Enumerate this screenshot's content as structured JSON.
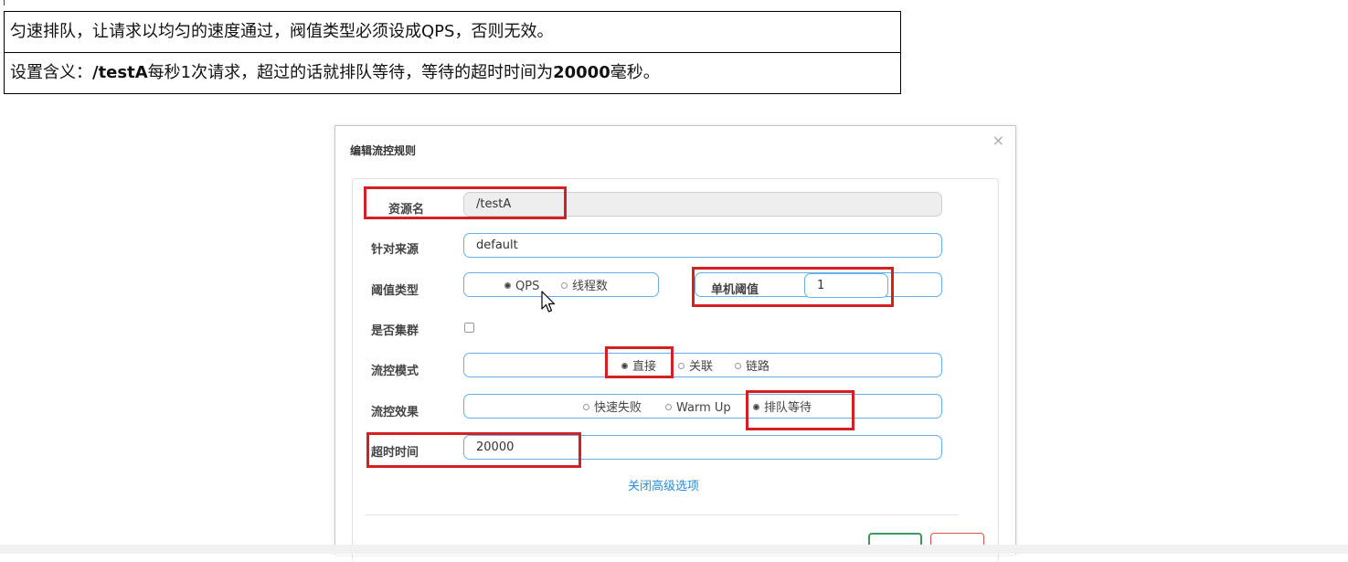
{
  "description": {
    "row1": "匀速排队，让请求以均匀的速度通过，阀值类型必须设成QPS，否则无效。",
    "row2_prefix": "设置含义：",
    "row2_bold": "/testA",
    "row2_mid": "每秒1次请求，超过的话就排队等待，等待的超时时间为",
    "row2_num": "20000",
    "row2_suffix": "毫秒。"
  },
  "dialog": {
    "title": "编辑流控规则",
    "close": "×",
    "resource": {
      "label": "资源名",
      "value": "/testA"
    },
    "origin": {
      "label": "针对来源",
      "value": "default"
    },
    "threshold_type": {
      "label": "阈值类型",
      "options": [
        "QPS",
        "线程数"
      ],
      "selected": "QPS"
    },
    "single_threshold": {
      "label": "单机阈值",
      "value": "1"
    },
    "cluster": {
      "label": "是否集群",
      "checked": false
    },
    "flow_mode": {
      "label": "流控模式",
      "options": [
        "直接",
        "关联",
        "链路"
      ],
      "selected": "直接"
    },
    "flow_effect": {
      "label": "流控效果",
      "options": [
        "快速失败",
        "Warm Up",
        "排队等待"
      ],
      "selected": "排队等待"
    },
    "timeout": {
      "label": "超时时间",
      "value": "20000"
    },
    "advanced_link": "关闭高级选项"
  },
  "colors": {
    "highlight": "#d42020",
    "link": "#2a8bd6",
    "focus_border": "#66afe9",
    "save_button": "#3c9a5f",
    "cancel_button": "#d9534f"
  },
  "icons": [
    "close-icon",
    "mouse-pointer-icon"
  ]
}
